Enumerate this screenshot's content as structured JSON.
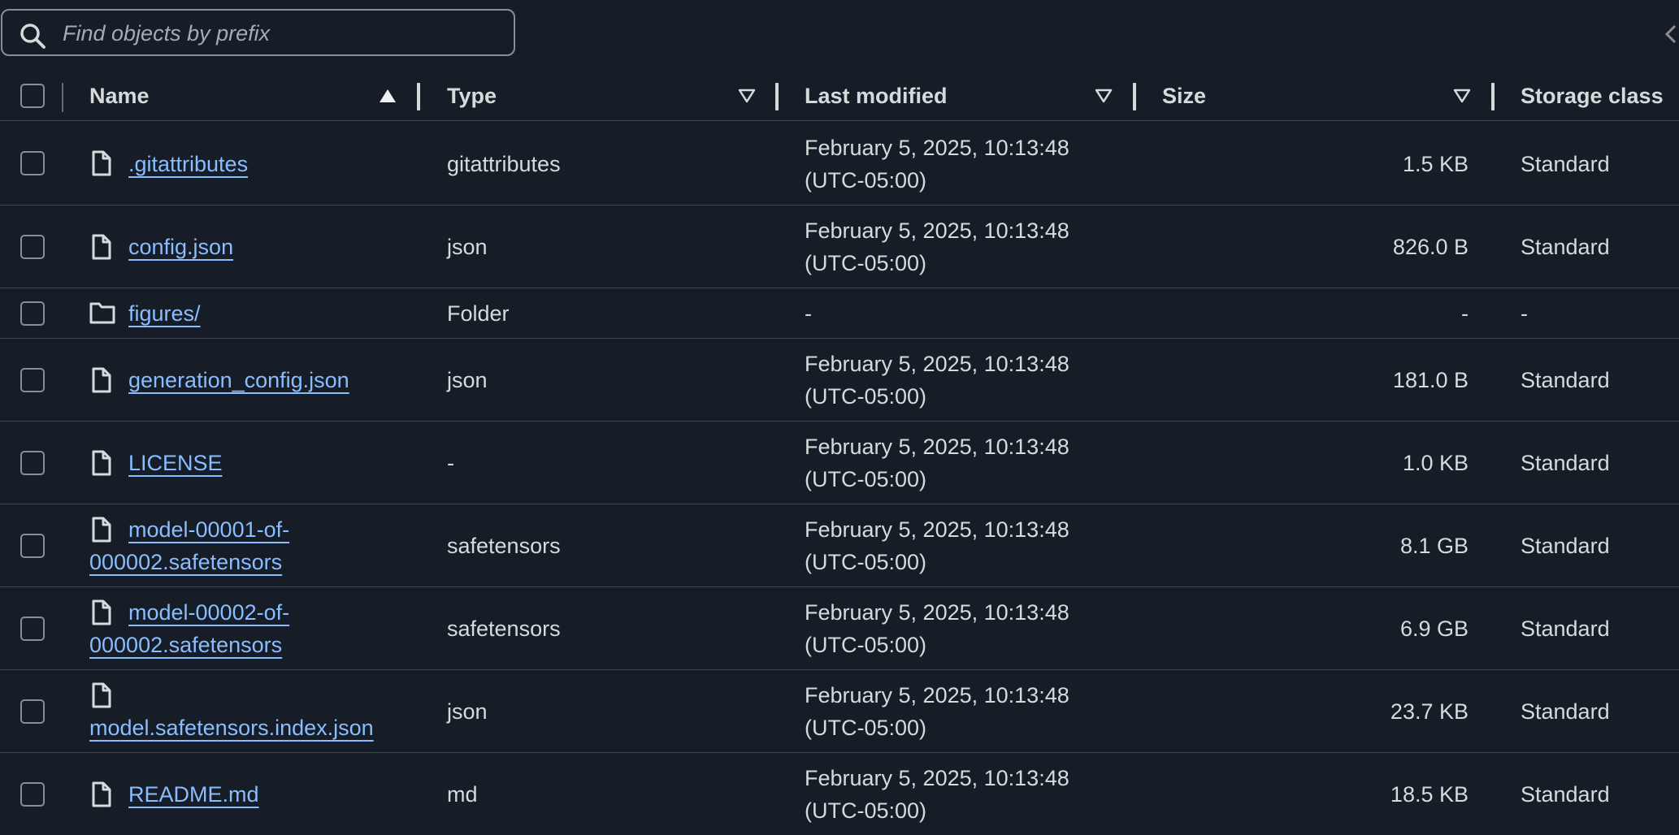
{
  "search": {
    "placeholder": "Find objects by prefix",
    "value": ""
  },
  "columns": {
    "name": "Name",
    "type": "Type",
    "last_modified": "Last modified",
    "size": "Size",
    "storage_class": "Storage class"
  },
  "rows": [
    {
      "icon": "file-icon",
      "name_line1": ".gitattributes",
      "name_line2": "",
      "type": "gitattributes",
      "modified_line1": "February 5, 2025, 10:13:48",
      "modified_line2": "(UTC-05:00)",
      "size": "1.5 KB",
      "storage": "Standard"
    },
    {
      "icon": "file-icon",
      "name_line1": "config.json",
      "name_line2": "",
      "type": "json",
      "modified_line1": "February 5, 2025, 10:13:48",
      "modified_line2": "(UTC-05:00)",
      "size": "826.0 B",
      "storage": "Standard"
    },
    {
      "icon": "folder-icon",
      "name_line1": "figures/",
      "name_line2": "",
      "type": "Folder",
      "modified_line1": "-",
      "modified_line2": "",
      "size": "-",
      "storage": "-"
    },
    {
      "icon": "file-icon",
      "name_line1": "generation_config.json",
      "name_line2": "",
      "type": "json",
      "modified_line1": "February 5, 2025, 10:13:48",
      "modified_line2": "(UTC-05:00)",
      "size": "181.0 B",
      "storage": "Standard"
    },
    {
      "icon": "file-icon",
      "name_line1": "LICENSE",
      "name_line2": "",
      "type": "-",
      "modified_line1": "February 5, 2025, 10:13:48",
      "modified_line2": "(UTC-05:00)",
      "size": "1.0 KB",
      "storage": "Standard"
    },
    {
      "icon": "file-icon",
      "name_line1": "model-00001-of-",
      "name_line2": "000002.safetensors",
      "type": "safetensors",
      "modified_line1": "February 5, 2025, 10:13:48",
      "modified_line2": "(UTC-05:00)",
      "size": "8.1 GB",
      "storage": "Standard"
    },
    {
      "icon": "file-icon",
      "name_line1": "model-00002-of-",
      "name_line2": "000002.safetensors",
      "type": "safetensors",
      "modified_line1": "February 5, 2025, 10:13:48",
      "modified_line2": "(UTC-05:00)",
      "size": "6.9 GB",
      "storage": "Standard"
    },
    {
      "icon": "file-icon",
      "name_line1": "",
      "name_line2": "model.safetensors.index.json",
      "type": "json",
      "modified_line1": "February 5, 2025, 10:13:48",
      "modified_line2": "(UTC-05:00)",
      "size": "23.7 KB",
      "storage": "Standard"
    },
    {
      "icon": "file-icon",
      "name_line1": "README.md",
      "name_line2": "",
      "type": "md",
      "modified_line1": "February 5, 2025, 10:13:48",
      "modified_line2": "(UTC-05:00)",
      "size": "18.5 KB",
      "storage": "Standard"
    }
  ],
  "colors": {
    "background": "#161d26",
    "link": "#89bdff",
    "text": "#d5dbdb",
    "divider": "#414750"
  }
}
